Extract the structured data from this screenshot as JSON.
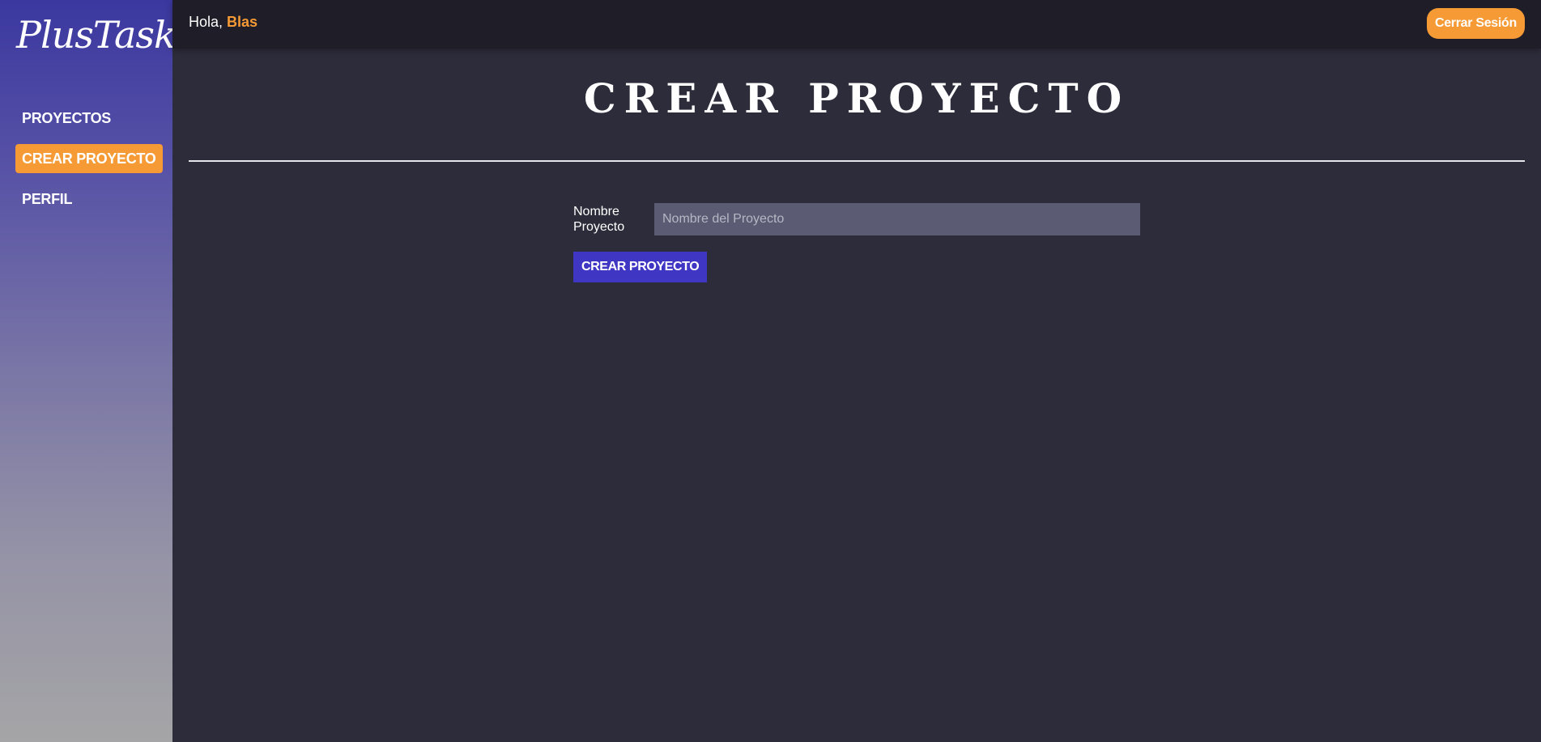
{
  "app": {
    "logo": "PlusTask"
  },
  "sidebar": {
    "items": [
      {
        "label": "PROYECTOS",
        "active": false
      },
      {
        "label": "CREAR PROYECTO",
        "active": true
      },
      {
        "label": "PERFIL",
        "active": false
      }
    ]
  },
  "header": {
    "greeting": "Hola,",
    "user_name": "Blas",
    "logout_label": "Cerrar Sesión"
  },
  "main": {
    "title": "CREAR PROYECTO",
    "form": {
      "name_label": "Nombre Proyecto",
      "name_value": "",
      "name_placeholder": "Nombre del Proyecto",
      "submit_label": "CREAR PROYECTO"
    }
  },
  "colors": {
    "accent": "#f59a35",
    "primary_button": "#4036c4",
    "background": "#2d2c3a",
    "topbar": "#1e1d28",
    "input_bg": "#5b5c74"
  }
}
